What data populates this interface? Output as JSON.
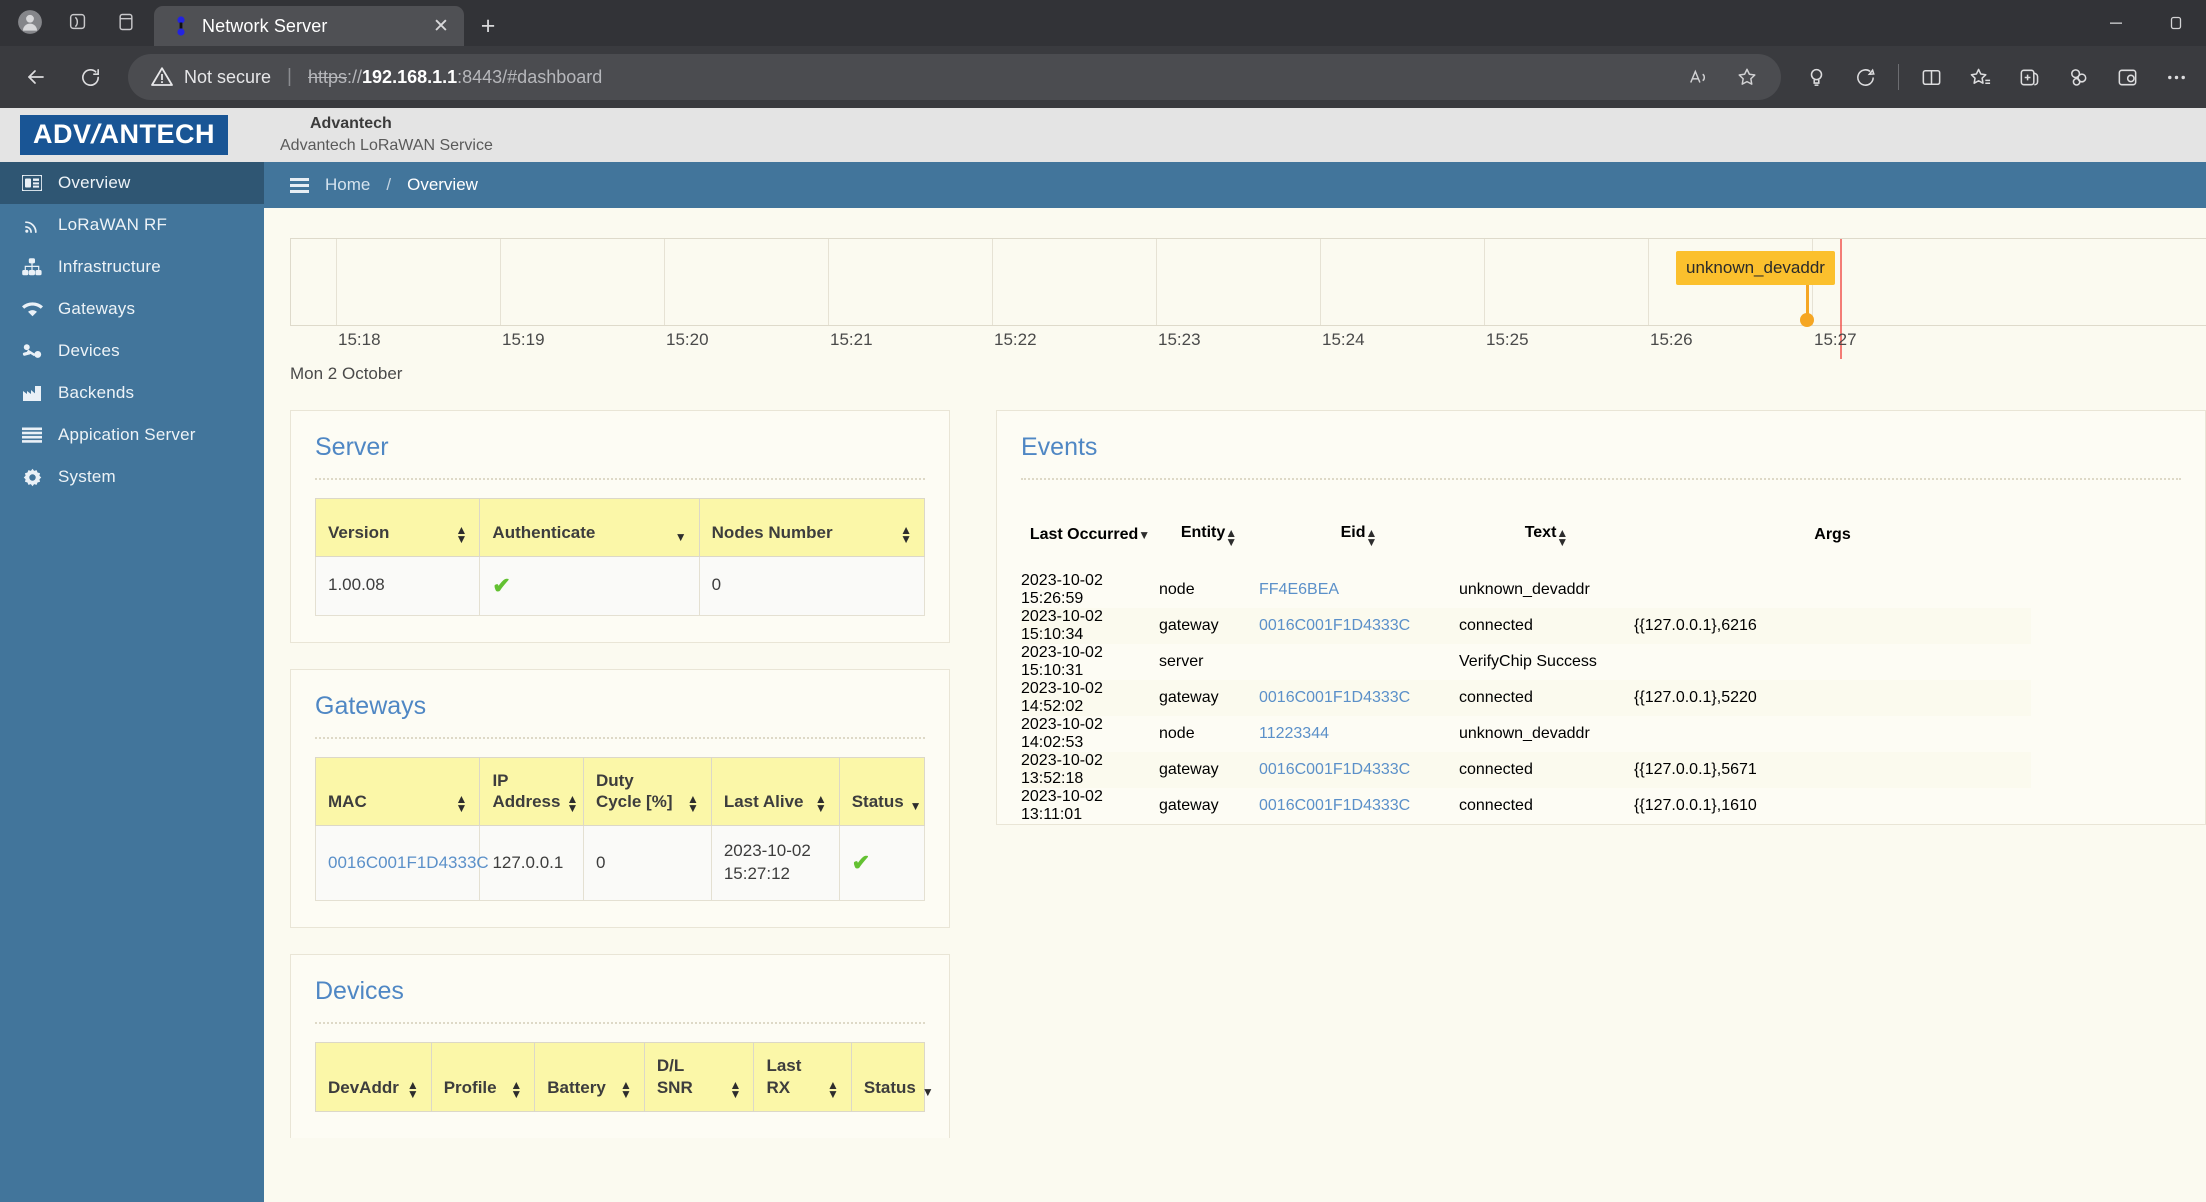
{
  "browser": {
    "tab": {
      "title": "Network Server",
      "favicon": "network-server-favicon",
      "close": "✕"
    },
    "new_tab": "+",
    "window": {
      "minimize": "–",
      "maximize": "❐"
    },
    "nav": {
      "back": "←",
      "reload": "↻"
    },
    "omnibox": {
      "security_text": "Not secure",
      "separator": "|",
      "url_scheme": "https",
      "url_scheme_suffix": "://",
      "url_host": "192.168.1.1",
      "url_rest": ":8443/#dashboard"
    },
    "toolbar_icons": [
      "read-aloud-icon",
      "favorite-star-icon",
      "split-screen-icon",
      "copilot-icon",
      "browser-essentials-icon",
      "collections-icon",
      "settings-more-icon",
      "profile-icon"
    ]
  },
  "app": {
    "brand": "ADVANTECH",
    "title": "Advantech",
    "subtitle": "Advantech LoRaWAN Service"
  },
  "sidebar": {
    "items": [
      {
        "label": "Overview",
        "icon": "overview-icon",
        "active": true
      },
      {
        "label": "LoRaWAN RF",
        "icon": "rf-signal-icon",
        "active": false
      },
      {
        "label": "Infrastructure",
        "icon": "infrastructure-icon",
        "active": false
      },
      {
        "label": "Gateways",
        "icon": "wifi-icon",
        "active": false
      },
      {
        "label": "Devices",
        "icon": "devices-icon",
        "active": false
      },
      {
        "label": "Backends",
        "icon": "chart-bar-icon",
        "active": false
      },
      {
        "label": "Appication Server",
        "icon": "server-list-icon",
        "active": false
      },
      {
        "label": "System",
        "icon": "gear-icon",
        "active": false
      }
    ]
  },
  "breadcrumb": {
    "menu": "hamburger-menu-icon",
    "home": "Home",
    "sep": "/",
    "current": "Overview"
  },
  "chart_data": {
    "type": "scatter",
    "title": "",
    "xlabel": "",
    "ylabel": "",
    "date_label": "Mon 2 October",
    "tick_labels": [
      "15:18",
      "15:19",
      "15:20",
      "15:21",
      "15:22",
      "15:23",
      "15:24",
      "15:25",
      "15:26",
      "15:27"
    ],
    "points": [
      {
        "x": "15:26:59",
        "label": "unknown_devaddr",
        "color": "#f5a623"
      }
    ],
    "now_marker": {
      "x": "15:27:12",
      "color": "#f0514e"
    },
    "grid": true,
    "legend": "none"
  },
  "server_panel": {
    "title": "Server",
    "columns": [
      {
        "label": "Version",
        "sort": "both"
      },
      {
        "label": "Authenticate",
        "sort": "down"
      },
      {
        "label": "Nodes Number",
        "sort": "both"
      }
    ],
    "rows": [
      {
        "version": "1.00.08",
        "authenticate": "✔",
        "nodes_number": "0"
      }
    ]
  },
  "gateways_panel": {
    "title": "Gateways",
    "columns": [
      {
        "label": "MAC",
        "sort": "both"
      },
      {
        "label": "IP Address",
        "sort": "both"
      },
      {
        "label": "Duty Cycle [%]",
        "sort": "both"
      },
      {
        "label": "Last Alive",
        "sort": "both"
      },
      {
        "label": "Status",
        "sort": "down"
      }
    ],
    "rows": [
      {
        "mac": "0016C001F1D4333C",
        "ip_address": "127.0.0.1",
        "duty_cycle": "0",
        "last_alive": "2023-10-02 15:27:12",
        "status": "✔"
      }
    ]
  },
  "devices_panel": {
    "title": "Devices",
    "columns": [
      {
        "label": "DevAddr",
        "sort": "both"
      },
      {
        "label": "Profile",
        "sort": "both"
      },
      {
        "label": "Battery",
        "sort": "both"
      },
      {
        "label": "D/L SNR",
        "sort": "both"
      },
      {
        "label": "Last RX",
        "sort": "both"
      },
      {
        "label": "Status",
        "sort": "down"
      }
    ],
    "rows": []
  },
  "events_panel": {
    "title": "Events",
    "columns": [
      {
        "label": "Last Occurred",
        "sort": "down"
      },
      {
        "label": "Entity",
        "sort": "both"
      },
      {
        "label": "Eid",
        "sort": "both"
      },
      {
        "label": "Text",
        "sort": "both"
      },
      {
        "label": "Args",
        "sort": "none"
      }
    ],
    "rows": [
      {
        "last_occurred": "2023-10-02 15:26:59",
        "entity": "node",
        "eid": "FF4E6BEA",
        "eid_link": true,
        "text": "unknown_devaddr",
        "args": ""
      },
      {
        "last_occurred": "2023-10-02 15:10:34",
        "entity": "gateway",
        "eid": "0016C001F1D4333C",
        "eid_link": true,
        "text": "connected",
        "args": "{{127.0.0.1},6216"
      },
      {
        "last_occurred": "2023-10-02 15:10:31",
        "entity": "server",
        "eid": "",
        "eid_link": false,
        "text": "VerifyChip Success",
        "args": ""
      },
      {
        "last_occurred": "2023-10-02 14:52:02",
        "entity": "gateway",
        "eid": "0016C001F1D4333C",
        "eid_link": true,
        "text": "connected",
        "args": "{{127.0.0.1},5220"
      },
      {
        "last_occurred": "2023-10-02 14:02:53",
        "entity": "node",
        "eid": "11223344",
        "eid_link": true,
        "text": "unknown_devaddr",
        "args": ""
      },
      {
        "last_occurred": "2023-10-02 13:52:18",
        "entity": "gateway",
        "eid": "0016C001F1D4333C",
        "eid_link": true,
        "text": "connected",
        "args": "{{127.0.0.1},5671"
      },
      {
        "last_occurred": "2023-10-02 13:11:01",
        "entity": "gateway",
        "eid": "0016C001F1D4333C",
        "eid_link": true,
        "text": "connected",
        "args": "{{127.0.0.1},1610"
      }
    ]
  },
  "colors": {
    "sidebar": "#42759b",
    "sidebar_active": "#2f5673",
    "brand_blue": "#195595",
    "panel_title": "#4f87c4",
    "table_header": "#fbf7a8",
    "link": "#5b90c9",
    "ok_check": "#63c132",
    "tooltip": "#fbc02d",
    "now_line": "#f0514e",
    "page_bg": "#fbfaf0"
  }
}
